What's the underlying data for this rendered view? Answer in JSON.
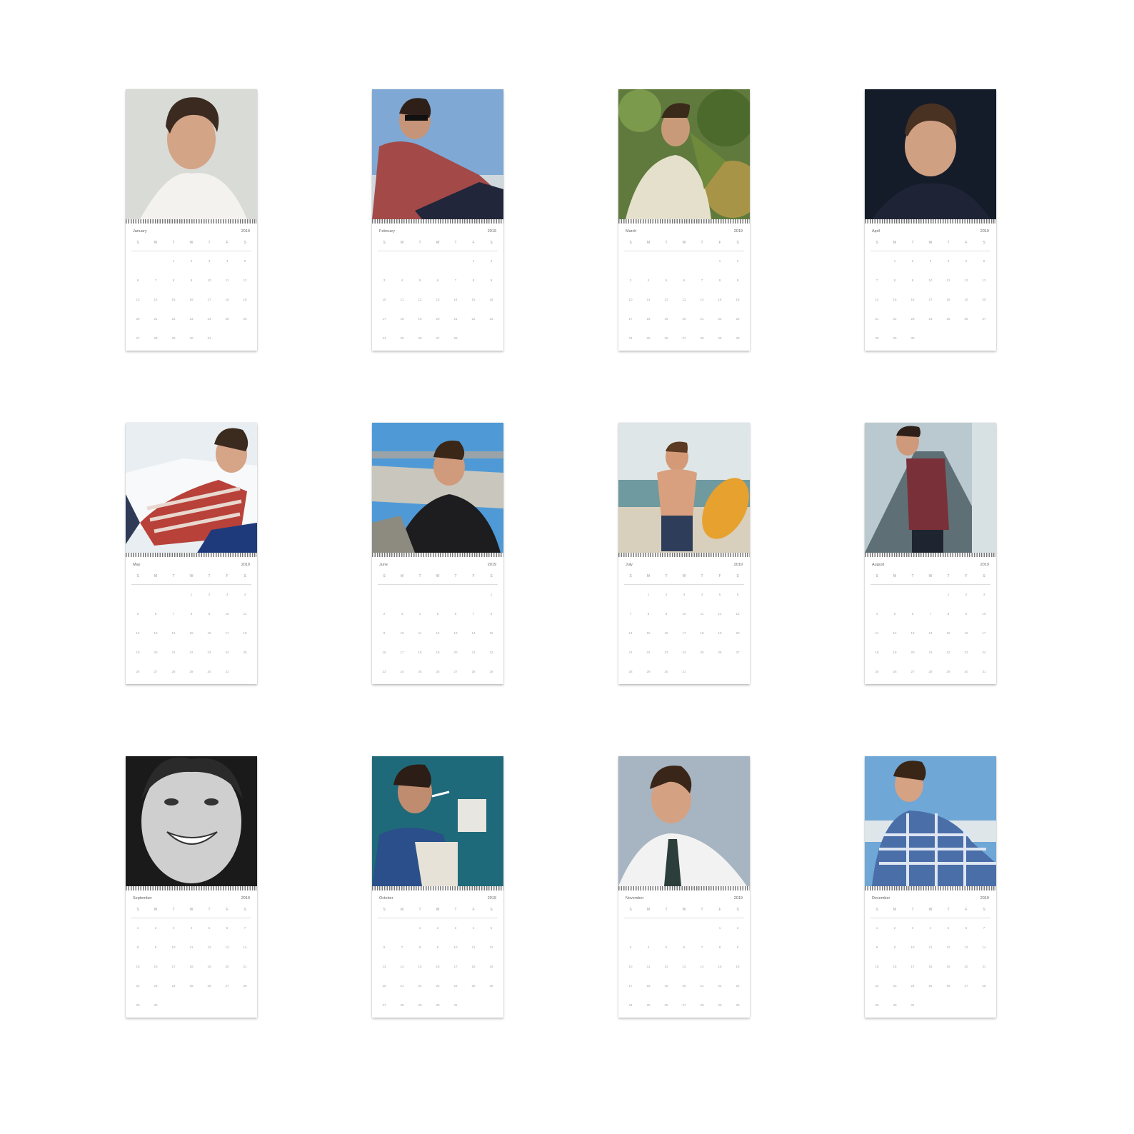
{
  "calendar": {
    "year": "2019",
    "weekdays": [
      "S",
      "M",
      "T",
      "W",
      "T",
      "F",
      "S"
    ],
    "pages": [
      {
        "month": "January",
        "photo": "portrait-white-tee-grey-backdrop"
      },
      {
        "month": "February",
        "photo": "sunglasses-striped-shirt-sky"
      },
      {
        "month": "March",
        "photo": "among-green-leaves"
      },
      {
        "month": "April",
        "photo": "smiling-dark-backdrop"
      },
      {
        "month": "May",
        "photo": "red-striped-sweater-reclining"
      },
      {
        "month": "June",
        "photo": "black-tee-concrete-river"
      },
      {
        "month": "July",
        "photo": "surfboard-beach"
      },
      {
        "month": "August",
        "photo": "maroon-tee-road"
      },
      {
        "month": "September",
        "photo": "black-and-white-smile"
      },
      {
        "month": "October",
        "photo": "teal-wall-denim-jacket"
      },
      {
        "month": "November",
        "photo": "white-shirt-tie-grey"
      },
      {
        "month": "December",
        "photo": "plaid-shirt-harbor"
      }
    ]
  },
  "colors": {
    "background": "#ffffff",
    "page": "#ffffff",
    "spiral": "#777777"
  }
}
